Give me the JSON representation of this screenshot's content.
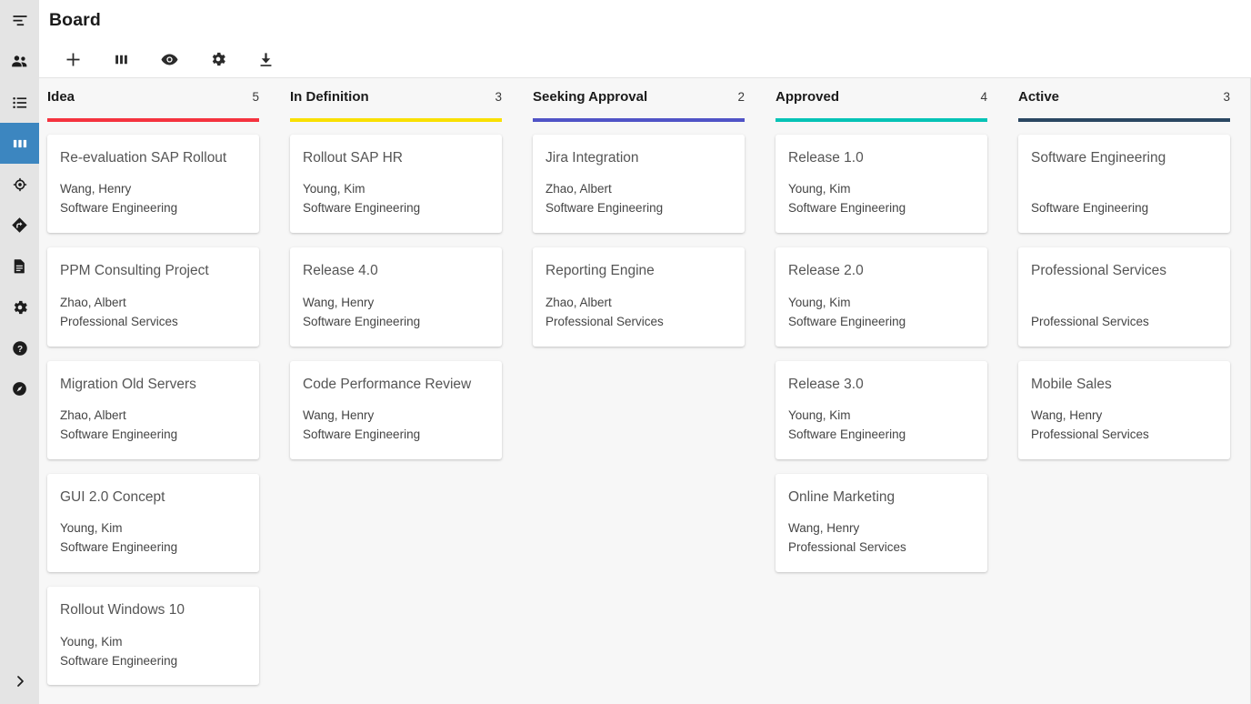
{
  "header": {
    "title": "Board"
  },
  "sidebar": {
    "items": [
      {
        "name": "menu-collapse",
        "icon": "menu-align-icon",
        "active": false
      },
      {
        "name": "people",
        "icon": "people-icon",
        "active": false
      },
      {
        "name": "list",
        "icon": "list-icon",
        "active": false
      },
      {
        "name": "board",
        "icon": "columns-icon",
        "active": true
      },
      {
        "name": "target",
        "icon": "target-icon",
        "active": false
      },
      {
        "name": "route",
        "icon": "diamond-arrow-icon",
        "active": false
      },
      {
        "name": "documents",
        "icon": "document-icon",
        "active": false
      },
      {
        "name": "settings",
        "icon": "gear-icon",
        "active": false
      },
      {
        "name": "help",
        "icon": "question-circle-icon",
        "active": false
      },
      {
        "name": "explore",
        "icon": "compass-icon",
        "active": false
      }
    ],
    "expand": {
      "name": "expand-sidebar",
      "icon": "chevron-right-icon"
    }
  },
  "toolbar": {
    "buttons": [
      {
        "name": "add-card-button",
        "icon": "plus-icon",
        "label": "Add"
      },
      {
        "name": "columns-button",
        "icon": "columns-icon",
        "label": "Columns"
      },
      {
        "name": "visibility-button",
        "icon": "eye-icon",
        "label": "Visibility"
      },
      {
        "name": "settings-button",
        "icon": "gear-icon",
        "label": "Settings"
      },
      {
        "name": "export-button",
        "icon": "download-icon",
        "label": "Export"
      }
    ]
  },
  "colors": {
    "idea": "#f5333f",
    "in_definition": "#f9e000",
    "seeking_approval": "#5053c6",
    "approved": "#06c3b6",
    "active": "#2a4762",
    "sidebar_active": "#3c86c0",
    "board_bg": "#f7f7f7"
  },
  "board": {
    "columns": [
      {
        "title": "Idea",
        "count": "5",
        "accent": "#f5333f",
        "cards": [
          {
            "title": "Re-evaluation SAP Rollout",
            "assignee": "Wang, Henry",
            "dept": "Software Engineering"
          },
          {
            "title": "PPM Consulting Project",
            "assignee": "Zhao, Albert",
            "dept": "Professional Services"
          },
          {
            "title": "Migration Old Servers",
            "assignee": "Zhao, Albert",
            "dept": "Software Engineering"
          },
          {
            "title": "GUI 2.0 Concept",
            "assignee": "Young, Kim",
            "dept": "Software Engineering"
          },
          {
            "title": "Rollout Windows 10",
            "assignee": "Young, Kim",
            "dept": "Software Engineering"
          }
        ]
      },
      {
        "title": "In Definition",
        "count": "3",
        "accent": "#f9e000",
        "cards": [
          {
            "title": "Rollout SAP HR",
            "assignee": "Young, Kim",
            "dept": "Software Engineering"
          },
          {
            "title": "Release 4.0",
            "assignee": "Wang, Henry",
            "dept": "Software Engineering"
          },
          {
            "title": "Code Performance Review",
            "assignee": "Wang, Henry",
            "dept": "Software Engineering"
          }
        ]
      },
      {
        "title": "Seeking Approval",
        "count": "2",
        "accent": "#5053c6",
        "cards": [
          {
            "title": "Jira Integration",
            "assignee": "Zhao, Albert",
            "dept": "Software Engineering"
          },
          {
            "title": "Reporting Engine",
            "assignee": "Zhao, Albert",
            "dept": "Professional Services"
          }
        ]
      },
      {
        "title": "Approved",
        "count": "4",
        "accent": "#06c3b6",
        "cards": [
          {
            "title": "Release 1.0",
            "assignee": "Young, Kim",
            "dept": "Software Engineering"
          },
          {
            "title": "Release 2.0",
            "assignee": "Young, Kim",
            "dept": "Software Engineering"
          },
          {
            "title": "Release 3.0",
            "assignee": "Young, Kim",
            "dept": "Software Engineering"
          },
          {
            "title": "Online Marketing",
            "assignee": "Wang, Henry",
            "dept": "Professional Services"
          }
        ]
      },
      {
        "title": "Active",
        "count": "3",
        "accent": "#2a4762",
        "cards": [
          {
            "title": "Software Engineering",
            "assignee": "",
            "dept": "Software Engineering"
          },
          {
            "title": "Professional Services",
            "assignee": "",
            "dept": "Professional Services"
          },
          {
            "title": "Mobile Sales",
            "assignee": "Wang, Henry",
            "dept": "Professional Services"
          }
        ]
      }
    ]
  }
}
